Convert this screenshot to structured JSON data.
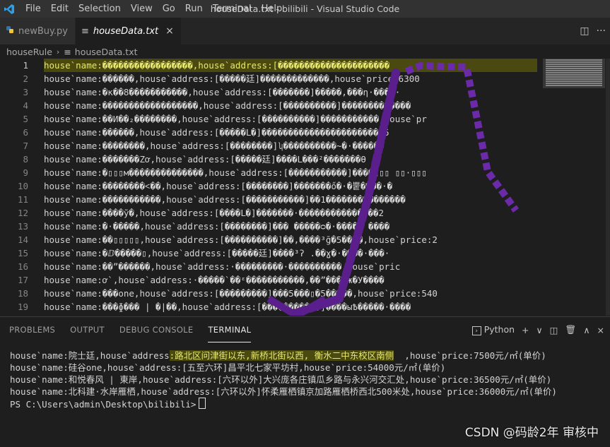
{
  "titlebar": {
    "menu": [
      "File",
      "Edit",
      "Selection",
      "View",
      "Go",
      "Run",
      "Terminal",
      "Help"
    ],
    "window_title": "houseData.txt - bilibili - Visual Studio Code",
    "accent": "#1e88e5"
  },
  "tabs": [
    {
      "label": "newBuy.py",
      "icon": "python-file-icon"
    },
    {
      "label": "houseData.txt",
      "icon": "text-file-icon",
      "close": "×"
    }
  ],
  "breadcrumb": {
    "folder": "houseRule",
    "file": "houseData.txt"
  },
  "editor": {
    "line_numbers": [
      "1",
      "2",
      "3",
      "4",
      "5",
      "6",
      "7",
      "8",
      "9",
      "10",
      "11",
      "12",
      "13",
      "14",
      "15",
      "16",
      "17",
      "18",
      "19"
    ],
    "lines": [
      "house`name:�����������������,house`address:[���������������������",
      "house`name:������,house`address:[�����廷]�������������,house`price:6300",
      "house`name:�κ��8�����������,house`address:[�������]�����,���η·���ϕ·",
      "house`name:������������������,house`address:[����������]�������������",
      "house`name:��И��₂��������,house`address:[����������]�����������,house`pr",
      "house`name:������,house`address:[�����Ⅼ�]����������������������ψ5",
      "house`name:��������,house`address:[��������]ʮ����������~�·�����ϋ",
      "house`name:�������Zơ,house`address:[�����廷]����Ⅼ���²�������Ѳ",
      "house`name:�▯▯▯м��������������,house`address:[�����������]����▯▯▯ ▯▯·▯▯▯",
      "house`name:��������˂��,house`address:[��������]�������ő�·�뿥����·�",
      "house`name:�����������,house`address:[�����������]��1���������������",
      "house`name:����ỹ�,house`address:[����Ⅼ�]�������·���������������2",
      "house`name:�·�����,house`address:[��������]��� �����ᴑ�·����� ����",
      "house`name:��▯▯▯▯▯,house`address:[����������]��,����³ḡ�5����,house`price:2",
      "house`name:�ⅅ�����▯,house`address:[�����廷]����³ʔ .��ɣ�·����·���·",
      "house`name:��”������,house`address:·���������·����������,house`pric",
      "house`name:ơ`,house`address:·�����`��ᵋ�����������,��”����ж�У����",
      "house`name:���one,house`address:[���������]���5���▯�5�����,house`price:540",
      "house`name:���ɸ��� | �|��,house`address:[�����������]����ыѢ�����·����"
    ]
  },
  "panel": {
    "tabs": [
      "PROBLEMS",
      "OUTPUT",
      "DEBUG CONSOLE",
      "TERMINAL"
    ],
    "shell": "Python",
    "actions": [
      "+",
      "∨",
      "split-icon",
      "trash-icon",
      "∧",
      "×"
    ],
    "terminal": {
      "line1_before": "house`name:院士廷,house`address",
      "line1_selected": ":路北区问津街以东,新桥北街以西, 衡水二中东校区南侧",
      "line1_after": "  ,house`price:7500元/㎡(单价)",
      "line2": "house`name:硅谷one,house`address:[五至六环]昌平北七家平坊村,house`price:54000元/㎡(单价)",
      "line3": "house`name:和悦春风 | 東岸,house`address:[六环以外]大兴庞各庄镇瓜乡路与永兴河交汇处,house`price:36500元/㎡(单价)",
      "line4": "house`name:北科建·水岸雁栖,house`address:[六环以外]怀柔雁栖镇京加路雁栖桥西北500米处,house`price:36000元/㎡(单价)",
      "prompt": "PS C:\\Users\\admin\\Desktop\\bilibili>"
    }
  },
  "watermark": "CSDN @码龄2年 审核中"
}
